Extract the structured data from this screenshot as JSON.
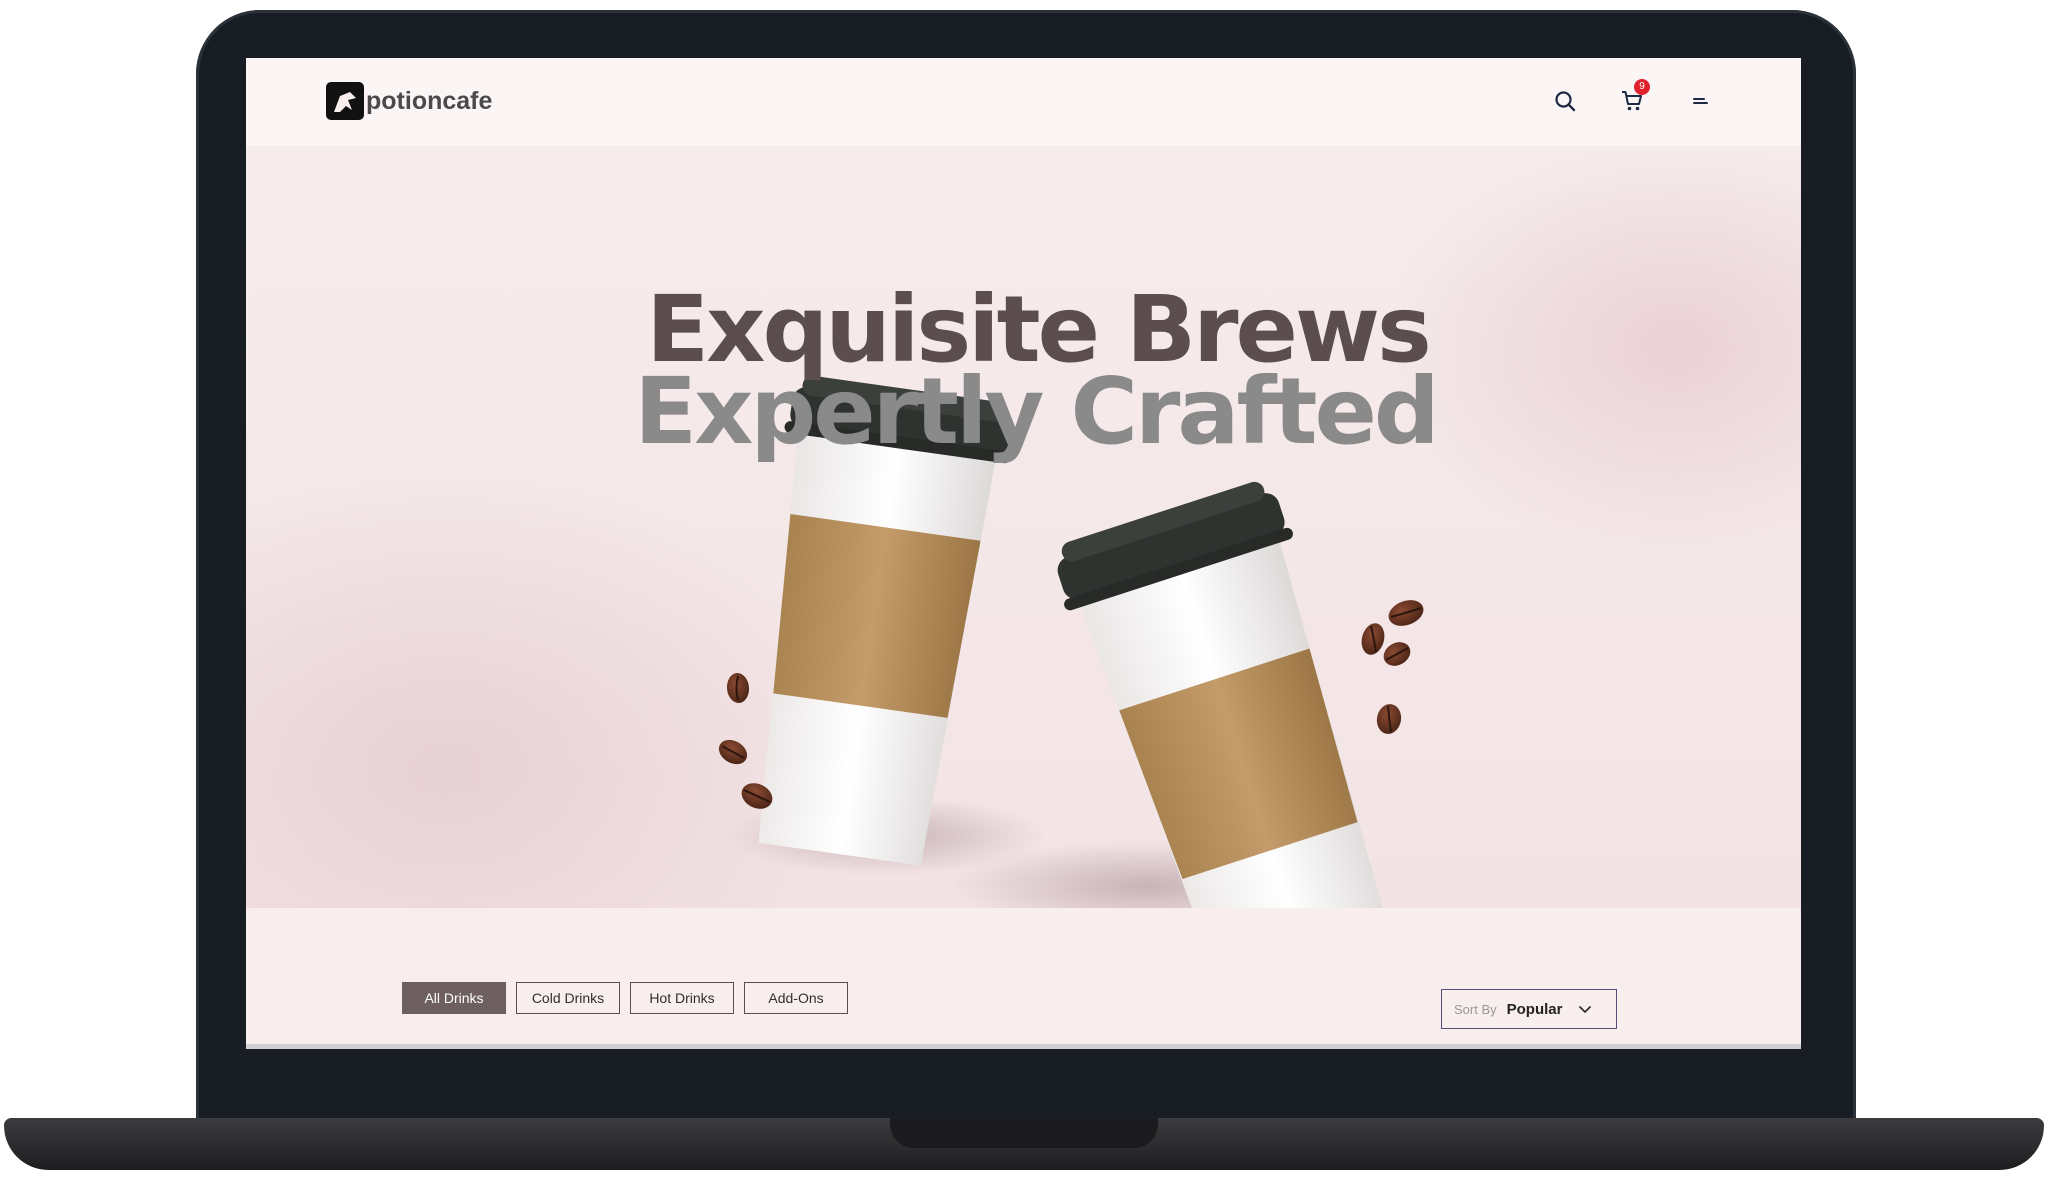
{
  "brand": {
    "name": "potioncafe"
  },
  "header": {
    "cart_count": "9",
    "icons": [
      "search-icon",
      "cart-icon",
      "menu-icon"
    ]
  },
  "hero": {
    "line1": "Exquisite Brews",
    "line2": "Expertly Crafted"
  },
  "filters": {
    "tabs": [
      {
        "label": "All Drinks",
        "active": true
      },
      {
        "label": "Cold Drinks",
        "active": false
      },
      {
        "label": "Hot Drinks",
        "active": false
      },
      {
        "label": "Add-Ons",
        "active": false
      }
    ]
  },
  "sort": {
    "label": "Sort By",
    "value": "Popular"
  },
  "colors": {
    "accent": "#6e6061",
    "title_dark": "#5c4d4e",
    "title_gray": "#8a8a8a",
    "badge": "#e0212b",
    "background": "#f8eeee"
  }
}
